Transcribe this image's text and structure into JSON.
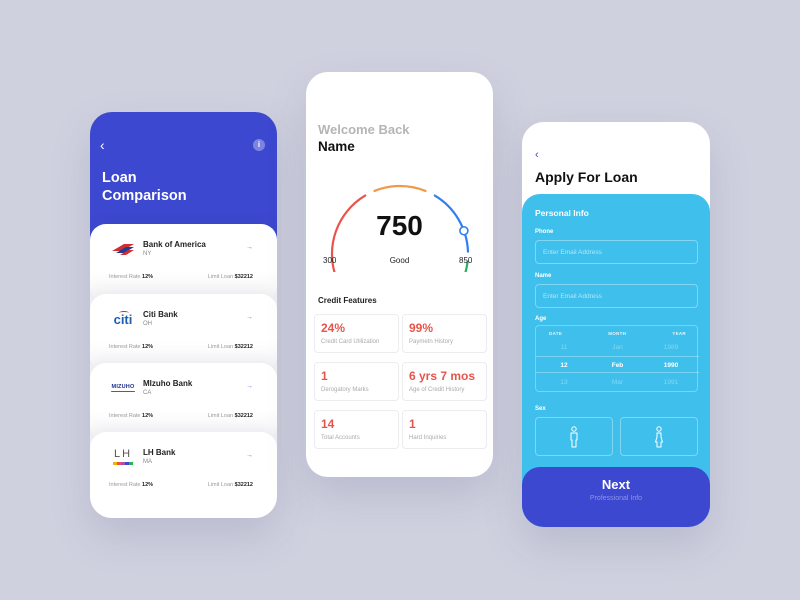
{
  "colors": {
    "background": "#cfd1df",
    "primary": "#3c48cf",
    "form_blue": "#3fc0ec",
    "accent_red": "#e8544a"
  },
  "loan_comparison": {
    "back_icon": "chevron-left-icon",
    "info_icon": "info-icon",
    "info_glyph": "i",
    "back_glyph": "‹",
    "title_line1": "Loan",
    "title_line2": "Comparison",
    "arrow_glyph": "→",
    "banks": [
      {
        "name": "Bank of America",
        "state": "NY",
        "interest_label": "Interest Rate",
        "interest": "12%",
        "limit_label": "Limit Loan",
        "limit": "$32212",
        "logo": "bank-of-america-logo"
      },
      {
        "name": "Citi Bank",
        "state": "OH",
        "interest_label": "Interest Rate",
        "interest": "12%",
        "limit_label": "Limit Loan",
        "limit": "$32212",
        "logo": "citi-logo",
        "logo_text": "citi"
      },
      {
        "name": "MIzuho Bank",
        "state": "CA",
        "interest_label": "Interest Rate",
        "interest": "12%",
        "limit_label": "Limit Loan",
        "limit": "$32212",
        "logo": "mizuho-logo",
        "logo_text": "MIZUHO"
      },
      {
        "name": "LH Bank",
        "state": "MA",
        "interest_label": "Interest Rate",
        "interest": "12%",
        "limit_label": "Limit Loan",
        "limit": "$32212",
        "logo": "lh-logo",
        "logo_text": "LH"
      }
    ]
  },
  "credit": {
    "welcome": "Welcome Back",
    "name": "Name",
    "gauge": {
      "score": "750",
      "rating": "Good",
      "min": "300",
      "max": "850",
      "score_value": 750,
      "range": [
        300,
        850
      ],
      "segment_colors": [
        "#e8544a",
        "#f0994a",
        "#2f7ff0",
        "#27b25a"
      ]
    },
    "section_title": "Credit Features",
    "features": [
      {
        "value": "24%",
        "label": "Credit Card Utilization"
      },
      {
        "value": "99%",
        "label": "Paymetn History"
      },
      {
        "value": "1",
        "label": "Derogatory Marks"
      },
      {
        "value": "6 yrs 7 mos",
        "label": "Age of Credit History"
      },
      {
        "value": "14",
        "label": "Total Accounts"
      },
      {
        "value": "1",
        "label": "Hard Inquiries"
      }
    ]
  },
  "apply": {
    "back_glyph": "‹",
    "title": "Apply For Loan",
    "section": "Personal Info",
    "phone_label": "Phone",
    "phone_placeholder": "Enter Email Address",
    "name_label": "Name",
    "name_placeholder": "Enter Email Address",
    "age_label": "Age",
    "picker": {
      "headers": [
        "DATE",
        "MONTH",
        "YEAR"
      ],
      "prev": [
        "11",
        "Jan",
        "1989"
      ],
      "selected": [
        "12",
        "Feb",
        "1990"
      ],
      "next": [
        "13",
        "Mar",
        "1991"
      ]
    },
    "sex_label": "Sex",
    "sex_options": [
      "male-icon",
      "female-icon"
    ],
    "next_label": "Next",
    "next_sub": "Professional Info"
  }
}
